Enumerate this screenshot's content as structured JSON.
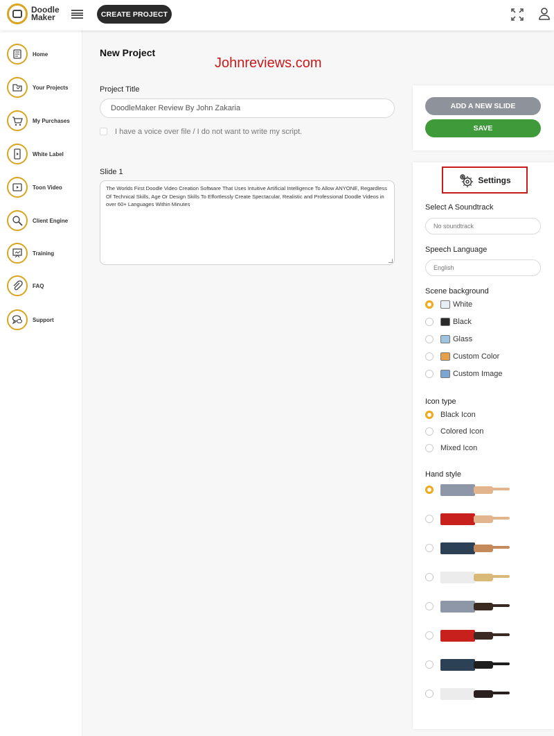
{
  "app": {
    "logo_line1": "Doodle",
    "logo_line2": "Maker"
  },
  "topbar": {
    "create_label": "CREATE PROJECT"
  },
  "sidebar": {
    "items": [
      {
        "label": "Home",
        "icon": "home-icon"
      },
      {
        "label": "Your Projects",
        "icon": "folder-icon"
      },
      {
        "label": "My Purchases",
        "icon": "cart-icon"
      },
      {
        "label": "White Label",
        "icon": "label-icon"
      },
      {
        "label": "Toon Video",
        "icon": "video-icon"
      },
      {
        "label": "Client Engine",
        "icon": "search-icon"
      },
      {
        "label": "Training",
        "icon": "training-icon"
      },
      {
        "label": "FAQ",
        "icon": "paperclip-icon"
      },
      {
        "label": "Support",
        "icon": "chat-icon"
      }
    ]
  },
  "main": {
    "page_title": "New Project",
    "watermark": "Johnreviews.com",
    "project_title_label": "Project Title",
    "project_title_value": "DoodleMaker Review By John Zakaria",
    "voice_over_label": "I have a voice over file / I do not want to write my script.",
    "slide_label": "Slide 1",
    "slide_text": "The Worlds First Doodle Video Creation Software That Uses Intuitive Artificial Intelligence To Allow ANYONE, Regardless Of Technical Skills, Age Or Design Skills To Effortlessly Create Spectacular, Realistic and Professional Doodle Videos in over 60+ Languages Within Minutes"
  },
  "actions": {
    "add_slide_label": "ADD A NEW SLIDE",
    "save_label": "SAVE"
  },
  "settings": {
    "title": "Settings",
    "soundtrack_label": "Select A Soundtrack",
    "soundtrack_value": "No soundtrack",
    "language_label": "Speech Language",
    "language_value": "English",
    "background_label": "Scene background",
    "backgrounds": [
      {
        "label": "White",
        "selected": true,
        "color": "#e8eef6"
      },
      {
        "label": "Black",
        "selected": false,
        "color": "#2a2a2a"
      },
      {
        "label": "Glass",
        "selected": false,
        "color": "#9fc4e0"
      },
      {
        "label": "Custom Color",
        "selected": false,
        "color": "#e6a04a"
      },
      {
        "label": "Custom Image",
        "selected": false,
        "color": "#7aa7d1"
      }
    ],
    "icon_type_label": "Icon type",
    "icon_types": [
      {
        "label": "Black Icon",
        "selected": true
      },
      {
        "label": "Colored Icon",
        "selected": false
      },
      {
        "label": "Mixed Icon",
        "selected": false
      }
    ],
    "hand_style_label": "Hand style",
    "hand_styles": [
      {
        "sleeve": "#8e97a8",
        "skin": "#e2b58f",
        "selected": true
      },
      {
        "sleeve": "#c8201c",
        "skin": "#e2b58f",
        "selected": false
      },
      {
        "sleeve": "#2c4156",
        "skin": "#c58a5c",
        "selected": false
      },
      {
        "sleeve": "#ececec",
        "skin": "#d9b87a",
        "selected": false
      },
      {
        "sleeve": "#8e97a8",
        "skin": "#3a2a22",
        "selected": false
      },
      {
        "sleeve": "#c8201c",
        "skin": "#3a2a22",
        "selected": false
      },
      {
        "sleeve": "#2c4156",
        "skin": "#1e1e1e",
        "selected": false
      },
      {
        "sleeve": "#ececec",
        "skin": "#2a2020",
        "selected": false
      }
    ]
  },
  "colors": {
    "accent": "#f0a91c",
    "gold": "#d9a520",
    "save": "#3f9a3a",
    "add": "#8e929a",
    "highlight": "#c81a1a"
  }
}
